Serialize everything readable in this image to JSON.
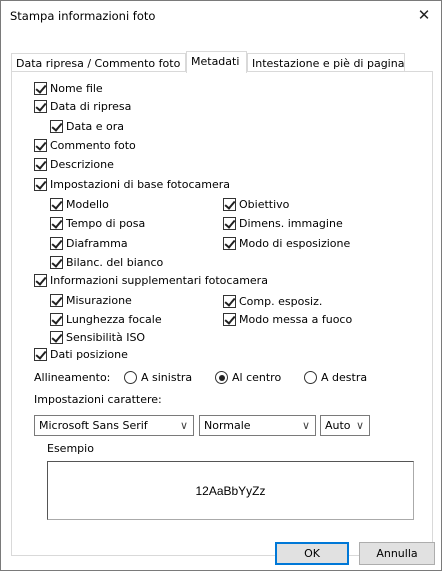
{
  "window": {
    "title": "Stampa informazioni foto",
    "close_symbol": "✕"
  },
  "tabs": [
    {
      "label": "Data ripresa / Commento foto",
      "active": false
    },
    {
      "label": "Metadati",
      "active": true
    },
    {
      "label": "Intestazione e piè di pagina",
      "active": false
    }
  ],
  "options": {
    "nome_file": {
      "label": "Nome file",
      "checked": true
    },
    "data_ripresa": {
      "label": "Data di ripresa",
      "checked": true
    },
    "data_ora": {
      "label": "Data e ora",
      "checked": true
    },
    "commento_foto": {
      "label": "Commento foto",
      "checked": true
    },
    "descrizione": {
      "label": "Descrizione",
      "checked": true
    },
    "impostazioni_base": {
      "label": "Impostazioni di base fotocamera",
      "checked": true
    },
    "modello": {
      "label": "Modello",
      "checked": true
    },
    "obiettivo": {
      "label": "Obiettivo",
      "checked": true
    },
    "tempo_posa": {
      "label": "Tempo di posa",
      "checked": true
    },
    "dimens_immagine": {
      "label": "Dimens. immagine",
      "checked": true
    },
    "diaframma": {
      "label": "Diaframma",
      "checked": true
    },
    "modo_esposizione": {
      "label": "Modo di esposizione",
      "checked": true
    },
    "bilanc_bianco": {
      "label": "Bilanc. del bianco",
      "checked": true
    },
    "info_supplementari": {
      "label": "Informazioni supplementari fotocamera",
      "checked": true
    },
    "misurazione": {
      "label": "Misurazione",
      "checked": true
    },
    "comp_esposiz": {
      "label": "Comp. esposiz.",
      "checked": true
    },
    "lunghezza_focale": {
      "label": "Lunghezza focale",
      "checked": true
    },
    "modo_messa_fuoco": {
      "label": "Modo messa a fuoco",
      "checked": true
    },
    "sensibilita_iso": {
      "label": "Sensibilità ISO",
      "checked": true
    },
    "dati_posizione": {
      "label": "Dati posizione",
      "checked": true
    }
  },
  "alignment": {
    "label": "Allineamento:",
    "options": [
      {
        "label": "A sinistra",
        "selected": false
      },
      {
        "label": "Al centro",
        "selected": true
      },
      {
        "label": "A destra",
        "selected": false
      }
    ]
  },
  "font_settings": {
    "label": "Impostazioni carattere:",
    "font": "Microsoft Sans Serif",
    "style": "Normale",
    "size": "Auto"
  },
  "example": {
    "label": "Esempio",
    "text": "12AaBbYyZz"
  },
  "buttons": {
    "ok": "OK",
    "cancel": "Annulla"
  }
}
